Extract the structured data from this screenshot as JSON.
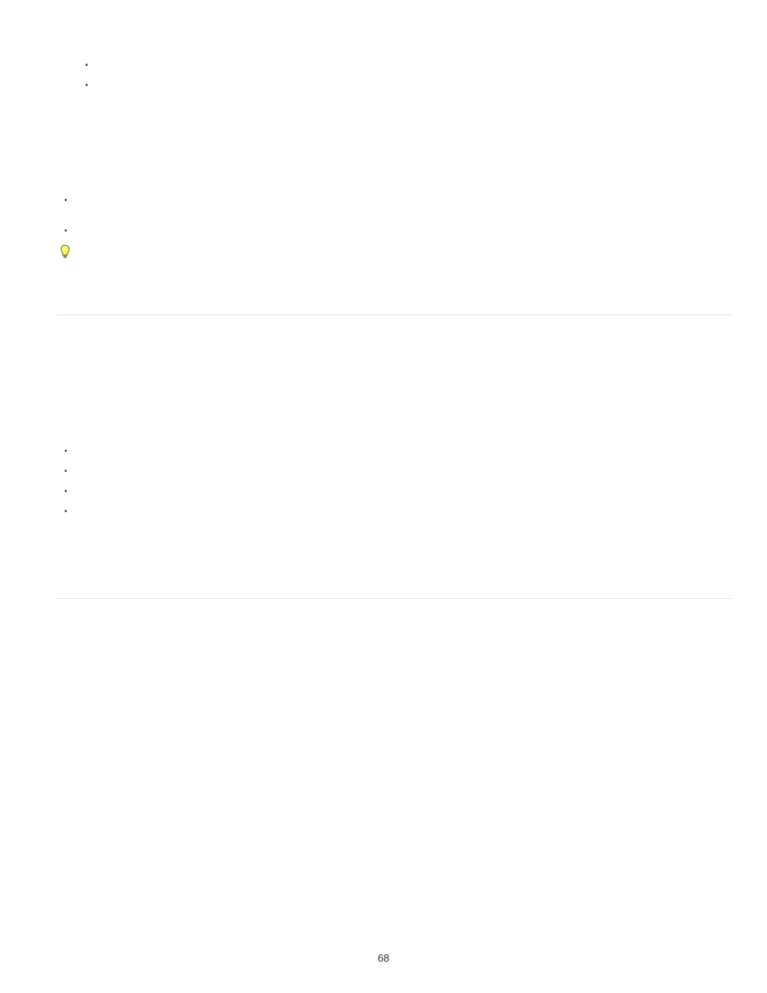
{
  "page_number": "68",
  "list1": {
    "items": [
      "",
      ""
    ]
  },
  "list2": {
    "items": [
      "",
      ""
    ]
  },
  "list3": {
    "items": [
      "",
      "",
      "",
      ""
    ]
  }
}
